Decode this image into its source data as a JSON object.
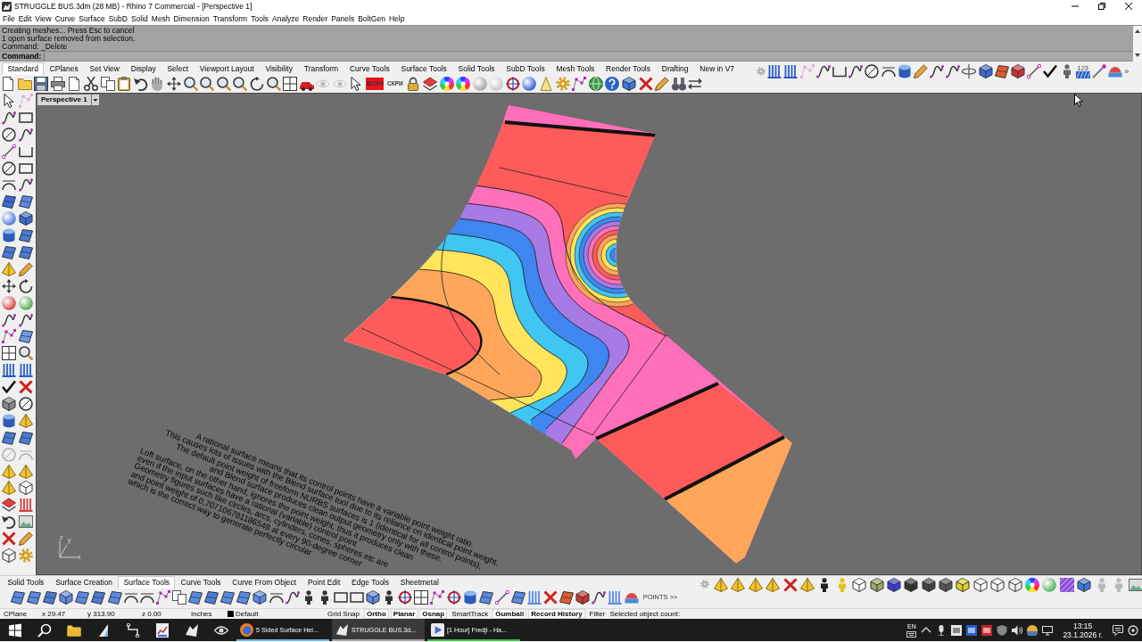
{
  "window": {
    "title": "STRUGGLE BUS.3dm (28 MB) - Rhino 7 Commercial - [Perspective 1]"
  },
  "menu": [
    "File",
    "Edit",
    "View",
    "Curve",
    "Surface",
    "SubD",
    "Solid",
    "Mesh",
    "Dimension",
    "Transform",
    "Tools",
    "Analyze",
    "Render",
    "Panels",
    "BoltGen",
    "Help"
  ],
  "command_line": {
    "history": [
      "Creating meshes... Press Esc to cancel",
      "1 open surface removed from selection.",
      "Command: _Delete"
    ],
    "prompt": "Command:"
  },
  "toolbar_tabs": [
    {
      "label": "Standard",
      "selected": true
    },
    {
      "label": "CPlanes",
      "selected": false
    },
    {
      "label": "Set View",
      "selected": false
    },
    {
      "label": "Display",
      "selected": false
    },
    {
      "label": "Select",
      "selected": false
    },
    {
      "label": "Viewport Layout",
      "selected": false
    },
    {
      "label": "Visibility",
      "selected": false
    },
    {
      "label": "Transform",
      "selected": false
    },
    {
      "label": "Curve Tools",
      "selected": false
    },
    {
      "label": "Surface Tools",
      "selected": false
    },
    {
      "label": "Solid Tools",
      "selected": false
    },
    {
      "label": "SubD Tools",
      "selected": false
    },
    {
      "label": "Mesh Tools",
      "selected": false
    },
    {
      "label": "Render Tools",
      "selected": false
    },
    {
      "label": "Drafting",
      "selected": false
    },
    {
      "label": "New in V7",
      "selected": false
    }
  ],
  "toolbar_text_buttons": [
    {
      "label": "ВСИЧ",
      "color": "#e8141c"
    },
    {
      "label": "СКРИ"
    }
  ],
  "right_toolbar": {
    "badge": "123",
    "overflow": "»"
  },
  "viewport": {
    "title": "Perspective 1",
    "annotation": {
      "whole_lines": [
        "A rational surface means that its control points have a variable point weight ratio.",
        "This causes lots of issues with the Blend surface tool due to its reliance on identical point weight.",
        "The default point weight of freeform NURBS surfaces is 1 (identical for all control points),",
        "and Blend surface produces clean output geometry only with these."
      ],
      "cut_lines": [
        "Loft surface, on the other hand, ignores the point weight, thus it produces clean",
        "even if the input surfaces have a rational (variable) control point",
        "Geometry figures such like circles, arcs, cylinders, cones, spheres etc are",
        "and point weight of 0,707106781186548 at every 90-degree corner",
        "which is the correct way to generate perfectly circular"
      ]
    },
    "axis_labels": [
      "z",
      "y",
      "x"
    ]
  },
  "bottom_tabs": [
    {
      "label": "Solid Tools",
      "selected": false
    },
    {
      "label": "Surface Creation",
      "selected": false
    },
    {
      "label": "Surface Tools",
      "selected": true
    },
    {
      "label": "Curve Tools",
      "selected": false
    },
    {
      "label": "Curve From Object",
      "selected": false
    },
    {
      "label": "Point Edit",
      "selected": false
    },
    {
      "label": "Edge Tools",
      "selected": false
    },
    {
      "label": "Sheetmetal",
      "selected": false
    }
  ],
  "bottom_toolbar": {
    "points_button": "POINTS >>"
  },
  "status_bar": {
    "cplane": "CPlane",
    "coordinates": [
      "x 29.47",
      "y 313.90",
      "z 0.00"
    ],
    "units": "Inches",
    "layer": "Default",
    "toggles": [
      {
        "label": "Grid Snap",
        "on": false
      },
      {
        "label": "Ortho",
        "on": true
      },
      {
        "label": "Planar",
        "on": true
      },
      {
        "label": "Osnap",
        "on": true
      },
      {
        "label": "SmartTrack",
        "on": false
      },
      {
        "label": "Gumball",
        "on": true
      },
      {
        "label": "Record History",
        "on": true
      },
      {
        "label": "Filter",
        "on": false
      }
    ],
    "selection": "Selected object count:"
  },
  "taskbar": {
    "apps": [
      {
        "label": "5 Sided Surface Hel...",
        "kind": "browser",
        "selected": false,
        "color": "#76b9ed"
      },
      {
        "label": "STRUGGLE BUS.3d...",
        "kind": "rhino",
        "selected": true,
        "color": "#a8a8a8"
      },
      {
        "label": "[1 Hour] Fredji - Ha...",
        "kind": "video",
        "selected": false,
        "color": "#3cc04a"
      }
    ],
    "language": "EN",
    "time": "13:15",
    "date": "23.1.2026 г."
  }
}
